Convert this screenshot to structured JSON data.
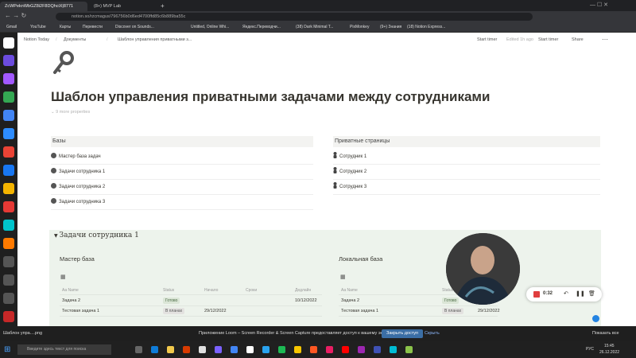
{
  "browser": {
    "tabs": [
      "ZcWPeknWbGZ8i2F8DQhciX|8771",
      "(8+) MVP Lab"
    ],
    "new_tab": "+",
    "url": "notion.so/rzcmagus/796756b0d6ed4700ffd85c6b889ba55c",
    "bookmarks": [
      "Gmail",
      "YouTube",
      "Карты",
      "Перевести",
      "Discover on Sounds...",
      "Untitled, Online Whi...",
      "Яндекс.Переводчи...",
      "(38) Dark Minimal T...",
      "PixMonkey",
      "(9+) Знания",
      "(18) Notion Express..."
    ]
  },
  "notion": {
    "breadcrumbs": [
      "Notion Today",
      "Документы",
      "Шаблон управления приватными з..."
    ],
    "topbar_right": [
      "Start timer",
      "Edited 1h ago",
      "Start timer",
      "Share"
    ],
    "page_icon": "key-icon",
    "title": "Шаблон управления приватными задачами между сотрудниками",
    "properties_label": "9 more properties",
    "left_column": {
      "header": "Базы",
      "items": [
        "Мастер база задач",
        "Задачи сотрудника 1",
        "Задачи сотрудника 2",
        "Задачи сотрудника 3"
      ]
    },
    "right_column": {
      "header": "Приватные страницы",
      "items": [
        "Сотрудник 1",
        "Сотрудник 2",
        "Сотрудник 3"
      ]
    },
    "toggle": {
      "title": "Задачи сотрудника 1",
      "left_db": {
        "title": "Мастер база",
        "columns": [
          "Aa Name",
          "Status",
          "Начало",
          "Сроки",
          "Дедлайн"
        ],
        "rows": [
          {
            "name": "Задача 2",
            "status": "Готово",
            "deadline": "10/12/2022"
          },
          {
            "name": "Тестовая задача 1",
            "status": "В планах",
            "start": "29/12/2022"
          }
        ]
      },
      "right_db": {
        "title": "Локальная база",
        "columns": [
          "Aa Name",
          "Status"
        ],
        "rows": [
          {
            "name": "Задача 2",
            "status": "Готово"
          },
          {
            "name": "Тестовая задача 1",
            "status": "В планах",
            "start": "29/12/2022"
          }
        ]
      }
    }
  },
  "recorder": {
    "time": "0:32"
  },
  "notice": {
    "text": "Приложение Loom – Screen Recorder & Screen Capture предоставляет доступ к вашему экрану.",
    "stop_button": "Закрыть доступ",
    "hide_button": "Скрыть",
    "filename": "Шаблон упра....png",
    "show_all": "Показать все"
  },
  "taskbar": {
    "search_placeholder": "Введите здесь текст для поиска",
    "language": "РУС",
    "time": "15:45",
    "date": "26.12.2022"
  },
  "colors": {
    "accent": "#2383e2",
    "toggle_bg": "#edf3ec",
    "record_red": "#e03e3e"
  }
}
